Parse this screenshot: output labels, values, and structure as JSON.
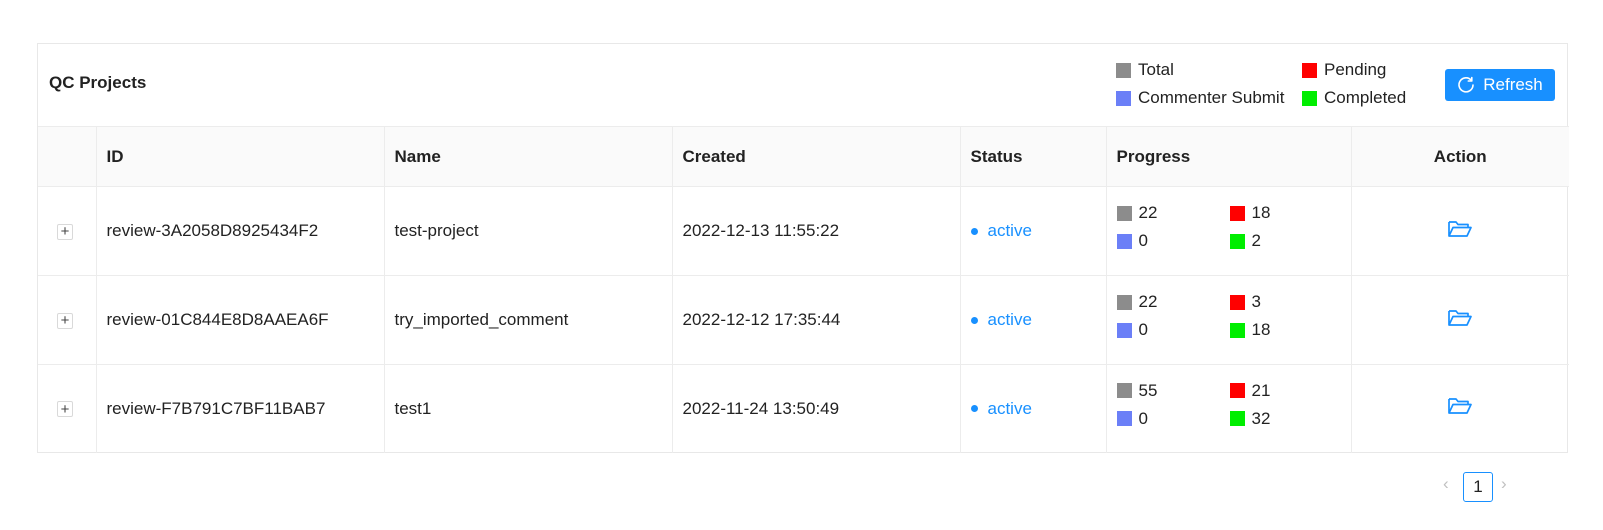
{
  "header": {
    "title": "QC Projects",
    "refresh_label": "Refresh"
  },
  "legend": [
    {
      "label": "Total",
      "color": "#8c8c8c"
    },
    {
      "label": "Pending",
      "color": "#ff0000"
    },
    {
      "label": "Commenter Submit",
      "color": "#6b7ff7"
    },
    {
      "label": "Completed",
      "color": "#00ee00"
    }
  ],
  "columns": [
    "",
    "ID",
    "Name",
    "Created",
    "Status",
    "Progress",
    "Action"
  ],
  "rows": [
    {
      "id": "review-3A2058D8925434F2",
      "name": "test-project",
      "created": "2022-12-13 11:55:22",
      "status": "active",
      "total": "22",
      "pending": "18",
      "commenter": "0",
      "completed": "2"
    },
    {
      "id": "review-01C844E8D8AAEA6F",
      "name": "try_imported_comment",
      "created": "2022-12-12 17:35:44",
      "status": "active",
      "total": "22",
      "pending": "3",
      "commenter": "0",
      "completed": "18"
    },
    {
      "id": "review-F7B791C7BF11BAB7",
      "name": "test1",
      "created": "2022-11-24 13:50:49",
      "status": "active",
      "total": "55",
      "pending": "21",
      "commenter": "0",
      "completed": "32"
    }
  ],
  "pagination": {
    "current": "1",
    "prev_icon": "chevron-left-icon",
    "next_icon": "chevron-right-icon"
  },
  "colors": {
    "accent": "#1890ff",
    "total": "#8c8c8c",
    "pending": "#ff0000",
    "commenter": "#6b7ff7",
    "completed": "#00ee00"
  },
  "icons": {
    "expand": "plus-icon",
    "action": "folder-open-icon",
    "refresh": "reload-icon"
  }
}
